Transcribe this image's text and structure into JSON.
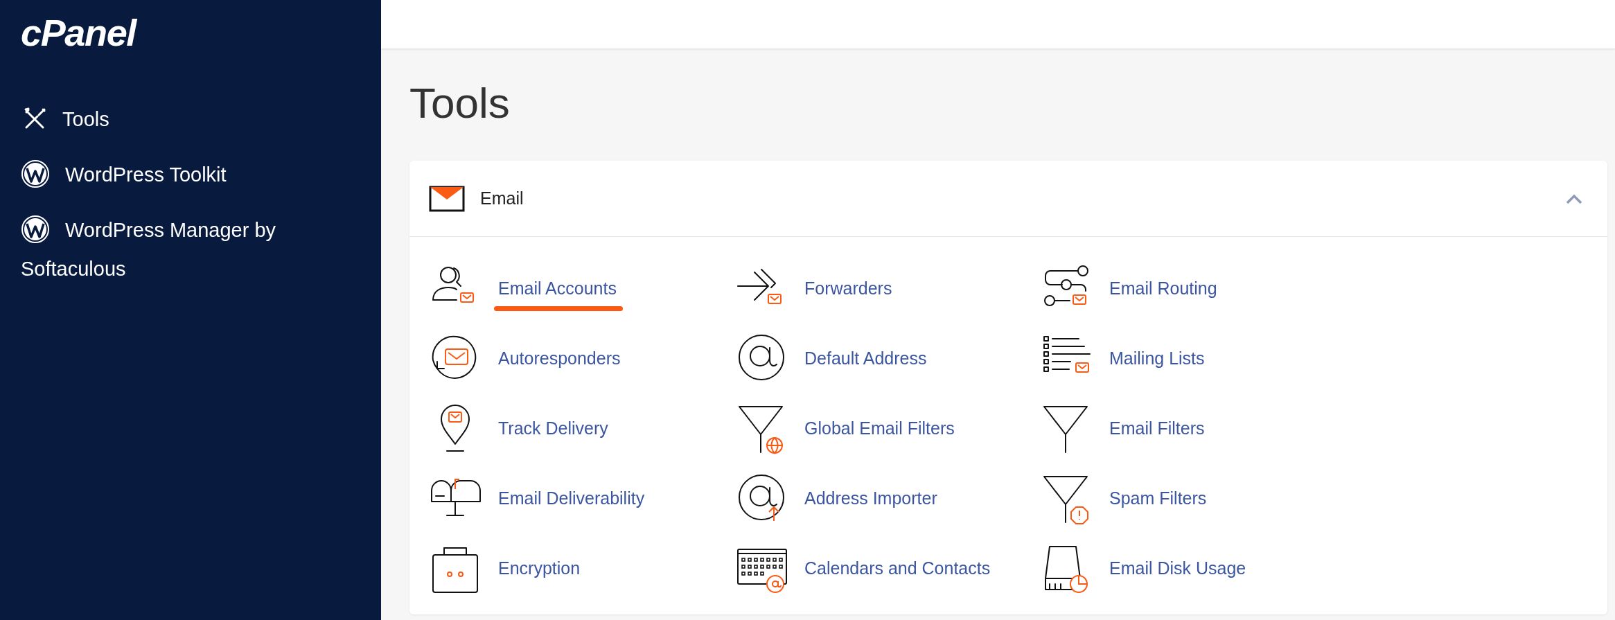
{
  "sidebar": {
    "logo": "cPanel",
    "items": [
      {
        "label": "Tools"
      },
      {
        "label": "WordPress Toolkit"
      },
      {
        "label": "WordPress Manager by Softaculous"
      }
    ]
  },
  "page_title": "Tools",
  "section": {
    "title": "Email",
    "expanded": true,
    "items": [
      {
        "label": "Email Accounts",
        "selected": true
      },
      {
        "label": "Forwarders",
        "selected": false
      },
      {
        "label": "Email Routing",
        "selected": false
      },
      {
        "label": "Autoresponders",
        "selected": false
      },
      {
        "label": "Default Address",
        "selected": false
      },
      {
        "label": "Mailing Lists",
        "selected": false
      },
      {
        "label": "Track Delivery",
        "selected": false
      },
      {
        "label": "Global Email Filters",
        "selected": false
      },
      {
        "label": "Email Filters",
        "selected": false
      },
      {
        "label": "Email Deliverability",
        "selected": false
      },
      {
        "label": "Address Importer",
        "selected": false
      },
      {
        "label": "Spam Filters",
        "selected": false
      },
      {
        "label": "Encryption",
        "selected": false
      },
      {
        "label": "Calendars and Contacts",
        "selected": false
      },
      {
        "label": "Email Disk Usage",
        "selected": false
      }
    ]
  }
}
